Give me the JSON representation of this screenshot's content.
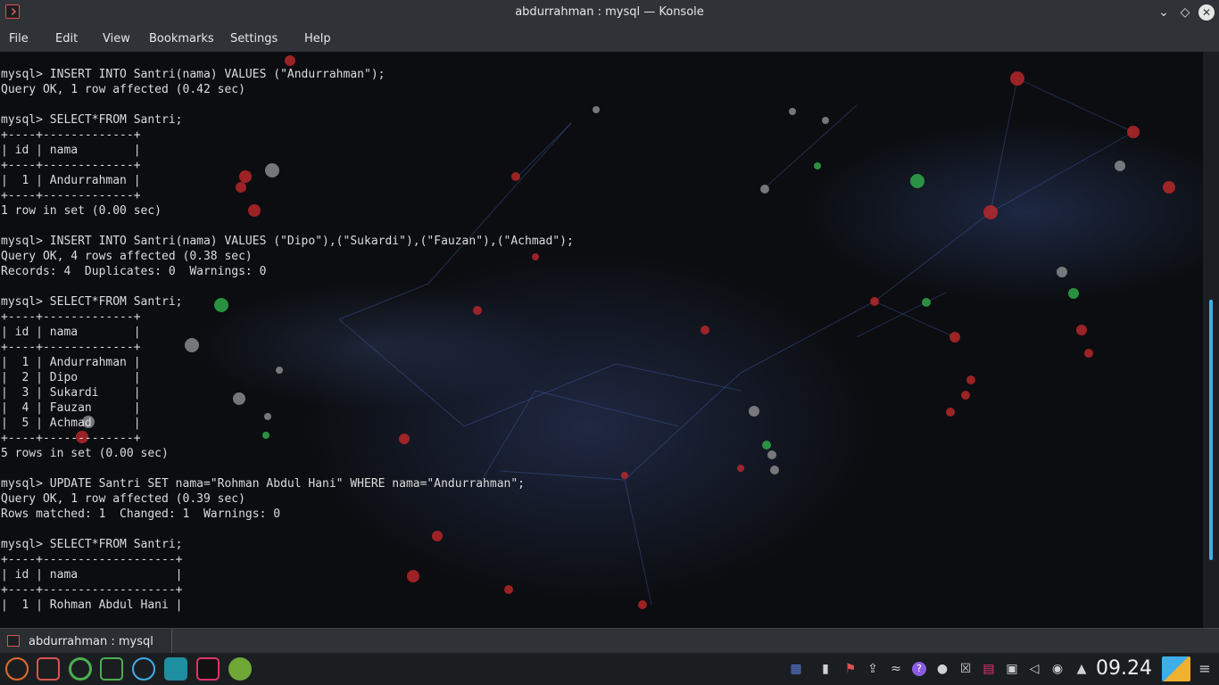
{
  "window": {
    "title": "abdurrahman : mysql — Konsole"
  },
  "menu": [
    "File",
    "Edit",
    "View",
    "Bookmarks",
    "Settings",
    "Help"
  ],
  "terminal": {
    "lines": [
      "mysql> INSERT INTO Santri(nama) VALUES (\"Andurrahman\");",
      "Query OK, 1 row affected (0.42 sec)",
      "",
      "mysql> SELECT*FROM Santri;",
      "+----+-------------+",
      "| id | nama        |",
      "+----+-------------+",
      "|  1 | Andurrahman |",
      "+----+-------------+",
      "1 row in set (0.00 sec)",
      "",
      "mysql> INSERT INTO Santri(nama) VALUES (\"Dipo\"),(\"Sukardi\"),(\"Fauzan\"),(\"Achmad\");",
      "Query OK, 4 rows affected (0.38 sec)",
      "Records: 4  Duplicates: 0  Warnings: 0",
      "",
      "mysql> SELECT*FROM Santri;",
      "+----+-------------+",
      "| id | nama        |",
      "+----+-------------+",
      "|  1 | Andurrahman |",
      "|  2 | Dipo        |",
      "|  3 | Sukardi     |",
      "|  4 | Fauzan      |",
      "|  5 | Achmad      |",
      "+----+-------------+",
      "5 rows in set (0.00 sec)",
      "",
      "mysql> UPDATE Santri SET nama=\"Rohman Abdul Hani\" WHERE nama=\"Andurrahman\";",
      "Query OK, 1 row affected (0.39 sec)",
      "Rows matched: 1  Changed: 1  Warnings: 0",
      "",
      "mysql> SELECT*FROM Santri;",
      "+----+-------------------+",
      "| id | nama              |",
      "+----+-------------------+",
      "|  1 | Rohman Abdul Hani |"
    ]
  },
  "tab": {
    "label": "abdurrahman : mysql"
  },
  "taskbar": {
    "clock": "09.24",
    "apps": [
      "app-launcher-icon",
      "window-switcher-icon",
      "chrome-icon",
      "file-manager-icon",
      "telegram-icon",
      "kde-connect-icon",
      "intellij-icon",
      "android-studio-icon"
    ]
  },
  "colors": {
    "accent": "#3daee9",
    "titlebar": "#2f3338",
    "terminal_text": "#dcdcdc"
  }
}
